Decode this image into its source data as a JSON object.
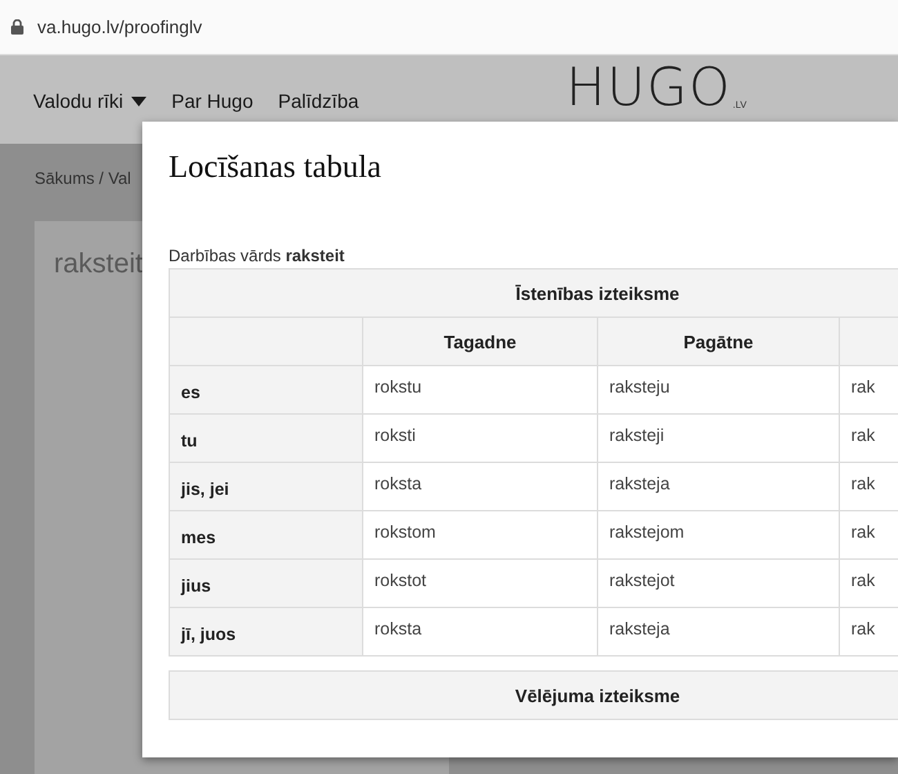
{
  "address_bar": {
    "url": "va.hugo.lv/proofinglv"
  },
  "nav": {
    "items": [
      {
        "label": "Valodu rīki",
        "has_dropdown": true
      },
      {
        "label": "Par Hugo",
        "has_dropdown": false
      },
      {
        "label": "Palīdzība",
        "has_dropdown": false
      }
    ]
  },
  "logo": {
    "text": "HUGO",
    "suffix": ".LV"
  },
  "breadcrumb": "Sākums / Val",
  "word_card": {
    "word": "raksteit"
  },
  "dialog": {
    "title": "Locīšanas tabula",
    "verb_label": "Darbības vārds **raksteit**",
    "tables": [
      {
        "mood": "Īstenības izteiksme",
        "columns": [
          "Tagadne",
          "Pagātne"
        ],
        "rows": [
          {
            "person": "es",
            "cells": [
              "rokstu",
              "raksteju",
              "rak"
            ]
          },
          {
            "person": "tu",
            "cells": [
              "roksti",
              "raksteji",
              "rak"
            ]
          },
          {
            "person": "jis, jei",
            "cells": [
              "roksta",
              "raksteja",
              "rak"
            ]
          },
          {
            "person": "mes",
            "cells": [
              "rokstom",
              "rakstejom",
              "rak"
            ]
          },
          {
            "person": "jius",
            "cells": [
              "rokstot",
              "rakstejot",
              "rak"
            ]
          },
          {
            "person": "jī, juos",
            "cells": [
              "roksta",
              "raksteja",
              "rak"
            ]
          }
        ]
      },
      {
        "mood": "Vēlējuma izteiksme"
      }
    ]
  }
}
